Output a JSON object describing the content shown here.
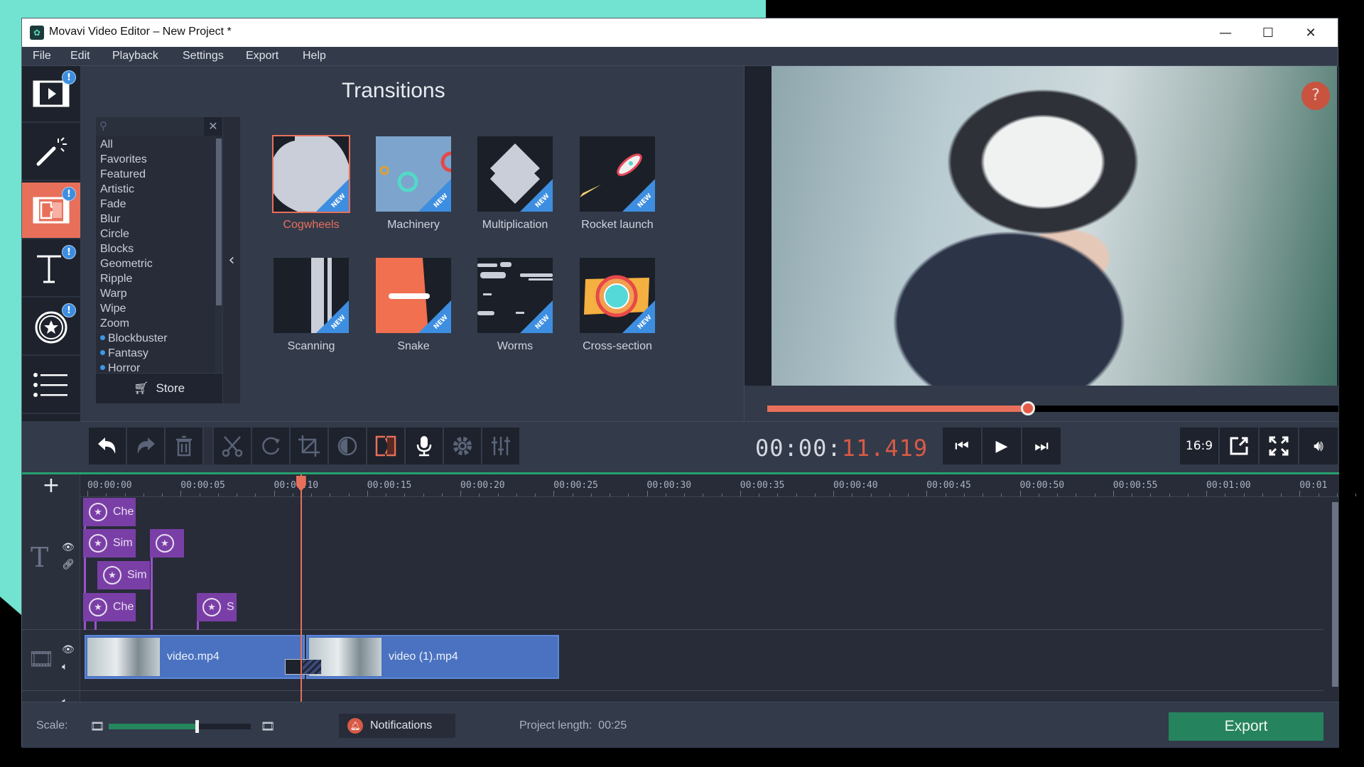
{
  "window": {
    "title": "Movavi Video Editor – New Project *",
    "minimize_glyph": "—",
    "maximize_glyph": "☐",
    "close_glyph": "✕"
  },
  "menu": [
    "File",
    "Edit",
    "Playback",
    "Settings",
    "Export",
    "Help"
  ],
  "sidebar": {
    "items": [
      {
        "name": "import-media",
        "icon": "film-play-icon",
        "badge": "!",
        "active": false
      },
      {
        "name": "filters",
        "icon": "magic-wand-icon",
        "badge": "",
        "active": false
      },
      {
        "name": "transitions",
        "icon": "film-puzzle-icon",
        "badge": "!",
        "active": true
      },
      {
        "name": "titles",
        "icon": "text-icon",
        "badge": "!",
        "active": false
      },
      {
        "name": "stickers",
        "icon": "star-sticker-icon",
        "badge": "!",
        "active": false
      },
      {
        "name": "more-tools",
        "icon": "list-icon",
        "badge": "",
        "active": false
      }
    ]
  },
  "transitions_panel": {
    "title": "Transitions",
    "search_placeholder": "",
    "clear_glyph": "✕",
    "categories": [
      {
        "label": "All",
        "dot": false
      },
      {
        "label": "Favorites",
        "dot": false
      },
      {
        "label": "Featured",
        "dot": false
      },
      {
        "label": "Artistic",
        "dot": false
      },
      {
        "label": "Fade",
        "dot": false
      },
      {
        "label": "Blur",
        "dot": false
      },
      {
        "label": "Circle",
        "dot": false
      },
      {
        "label": "Blocks",
        "dot": false
      },
      {
        "label": "Geometric",
        "dot": false
      },
      {
        "label": "Ripple",
        "dot": false
      },
      {
        "label": "Warp",
        "dot": false
      },
      {
        "label": "Wipe",
        "dot": false
      },
      {
        "label": "Zoom",
        "dot": false
      },
      {
        "label": "Blockbuster",
        "dot": true
      },
      {
        "label": "Fantasy",
        "dot": true
      },
      {
        "label": "Horror",
        "dot": true
      }
    ],
    "store_label": "Store",
    "collapse_glyph": "‹",
    "new_badge": "NEW",
    "tiles": [
      {
        "label": "Cogwheels",
        "selected": true
      },
      {
        "label": "Machinery",
        "selected": false
      },
      {
        "label": "Multiplication",
        "selected": false
      },
      {
        "label": "Rocket launch",
        "selected": false
      },
      {
        "label": "Scanning",
        "selected": false
      },
      {
        "label": "Snake",
        "selected": false
      },
      {
        "label": "Worms",
        "selected": false
      },
      {
        "label": "Cross-section",
        "selected": false
      }
    ]
  },
  "preview": {
    "help_glyph": "?",
    "progress_fraction": 0.457
  },
  "toolbar": {
    "tools": [
      "undo",
      "redo",
      "delete",
      "cut",
      "rotate",
      "crop",
      "color-adjust",
      "transition-wizard",
      "record-voice",
      "clip-properties",
      "audio-equalizer"
    ]
  },
  "player": {
    "timecode_prefix": "00:00:",
    "timecode_value": "11.419",
    "aspect_label": "16:9",
    "buttons": [
      "previous",
      "play",
      "next"
    ],
    "view_buttons": [
      "aspect-ratio",
      "detach-preview",
      "fullscreen",
      "volume"
    ]
  },
  "timeline": {
    "add_glyph": "+",
    "ruler_labels": [
      "00:00:00",
      "00:00:05",
      "00:00:10",
      "00:00:15",
      "00:00:20",
      "00:00:25",
      "00:00:30",
      "00:00:35",
      "00:00:40",
      "00:00:45",
      "00:00:50",
      "00:00:55",
      "00:01:00",
      "00:01"
    ],
    "playhead_seconds": 11.419,
    "title_clips": [
      {
        "label": "Che",
        "row": 0
      },
      {
        "label": "Sim",
        "row": 1
      },
      {
        "label": "",
        "row": 1
      },
      {
        "label": "Sim",
        "row": 2
      },
      {
        "label": "Che",
        "row": 3
      },
      {
        "label": "S",
        "row": 3
      }
    ],
    "video_clips": [
      {
        "name": "video.mp4"
      },
      {
        "name": "video (1).mp4"
      }
    ]
  },
  "footer": {
    "scale_label": "Scale:",
    "scale_fraction": 0.62,
    "notifications_label": "Notifications",
    "project_length_label": "Project length:",
    "project_length_value": "00:25",
    "export_label": "Export"
  },
  "colors": {
    "accent": "#e8705a",
    "export_green": "#25845e",
    "title_clip_purple": "#7a3fa6",
    "video_clip_blue": "#4a72c0",
    "new_badge_blue": "#3d8ee0"
  }
}
